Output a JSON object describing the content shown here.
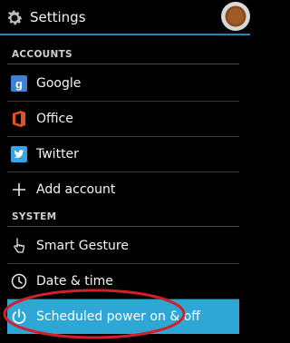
{
  "header": {
    "title": "Settings",
    "app_icon": "gear-icon",
    "avatar_icon": "avatar-icon"
  },
  "sections": {
    "accounts": "ACCOUNTS",
    "system": "SYSTEM"
  },
  "accounts": [
    {
      "label": "Google",
      "icon": "google-icon"
    },
    {
      "label": "Office",
      "icon": "office-icon"
    },
    {
      "label": "Twitter",
      "icon": "twitter-icon"
    },
    {
      "label": "Add account",
      "icon": "plus-icon"
    }
  ],
  "system": [
    {
      "label": "Smart Gesture",
      "icon": "gesture-hand-icon"
    },
    {
      "label": "Date & time",
      "icon": "clock-icon"
    },
    {
      "label": "Scheduled power on & off",
      "icon": "power-icon",
      "selected": true
    }
  ],
  "colors": {
    "accent": "#2fa7d6",
    "annotation": "#d21f2a",
    "background": "#000000"
  }
}
